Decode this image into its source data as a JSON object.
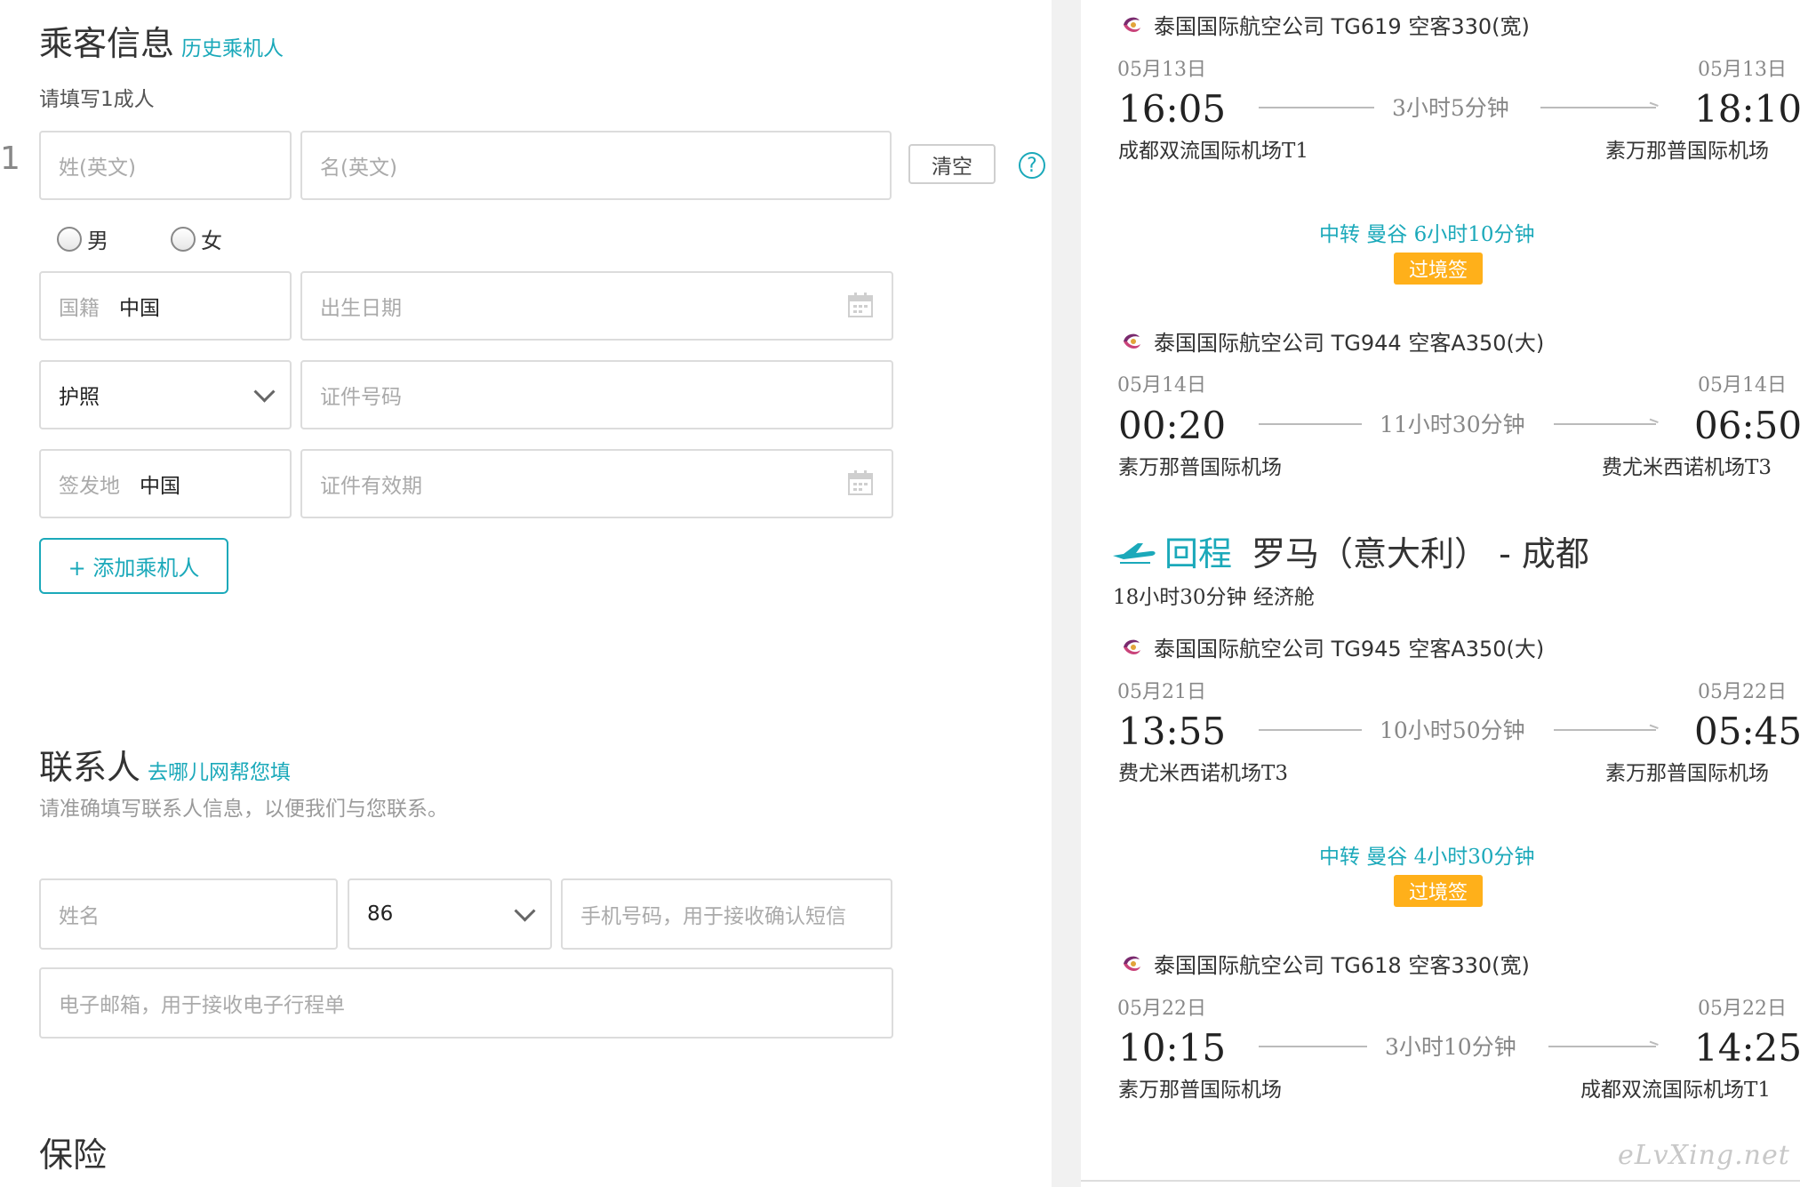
{
  "passenger": {
    "title": "乘客信息",
    "history_link": "历史乘机人",
    "hint": "请填写1成人",
    "index": "1",
    "surname_placeholder": "姓(英文)",
    "given_placeholder": "名(英文)",
    "clear_label": "清空",
    "help_label": "?",
    "gender_male": "男",
    "gender_female": "女",
    "nationality_label": "国籍",
    "nationality_value": "中国",
    "birth_placeholder": "出生日期",
    "doc_type_value": "护照",
    "doc_number_placeholder": "证件号码",
    "issue_place_label": "签发地",
    "issue_place_value": "中国",
    "doc_expiry_placeholder": "证件有效期",
    "add_passenger_label": "+ 添加乘机人"
  },
  "contact": {
    "title": "联系人",
    "help_link": "去哪儿网帮您填",
    "hint": "请准确填写联系人信息，以便我们与您联系。",
    "name_placeholder": "姓名",
    "country_code_value": "86",
    "phone_placeholder": "手机号码，用于接收确认短信",
    "email_placeholder": "电子邮箱，用于接收电子行程单"
  },
  "insurance": {
    "title": "保险"
  },
  "itinerary": {
    "segments": [
      {
        "flight": "泰国国际航空公司 TG619 空客330(宽)",
        "dep_date": "05月13日",
        "arr_date": "05月13日",
        "dep_time": "16:05",
        "arr_time": "18:10",
        "duration": "3小时5分钟",
        "dep_airport": "成都双流国际机场T1",
        "arr_airport": "素万那普国际机场"
      },
      {
        "flight": "泰国国际航空公司 TG944 空客A350(大)",
        "dep_date": "05月14日",
        "arr_date": "05月14日",
        "dep_time": "00:20",
        "arr_time": "06:50",
        "duration": "11小时30分钟",
        "dep_airport": "素万那普国际机场",
        "arr_airport": "费尤米西诺机场T3"
      },
      {
        "flight": "泰国国际航空公司 TG945 空客A350(大)",
        "dep_date": "05月21日",
        "arr_date": "05月22日",
        "dep_time": "13:55",
        "arr_time": "05:45",
        "duration": "10小时50分钟",
        "dep_airport": "费尤米西诺机场T3",
        "arr_airport": "素万那普国际机场"
      },
      {
        "flight": "泰国国际航空公司 TG618 空客330(宽)",
        "dep_date": "05月22日",
        "arr_date": "05月22日",
        "dep_time": "10:15",
        "arr_time": "14:25",
        "duration": "3小时10分钟",
        "dep_airport": "素万那普国际机场",
        "arr_airport": "成都双流国际机场T1"
      }
    ],
    "transfers": [
      {
        "text": "中转  曼谷  6小时10分钟",
        "badge": "过境签"
      },
      {
        "text": "中转  曼谷  4小时30分钟",
        "badge": "过境签"
      }
    ],
    "return_leg": {
      "label": "回程",
      "route": "罗马（意大利） - 成都",
      "summary": "18小时30分钟  经济舱"
    }
  },
  "watermark": "eLvXing.net",
  "colors": {
    "accent": "#1ba9ba",
    "badge": "#ffb01a",
    "airline_logo": "#7a2a6e"
  },
  "icons": [
    "calendar-icon",
    "chevron-down-icon",
    "help-icon",
    "airline-logo-icon",
    "plane-icon"
  ]
}
